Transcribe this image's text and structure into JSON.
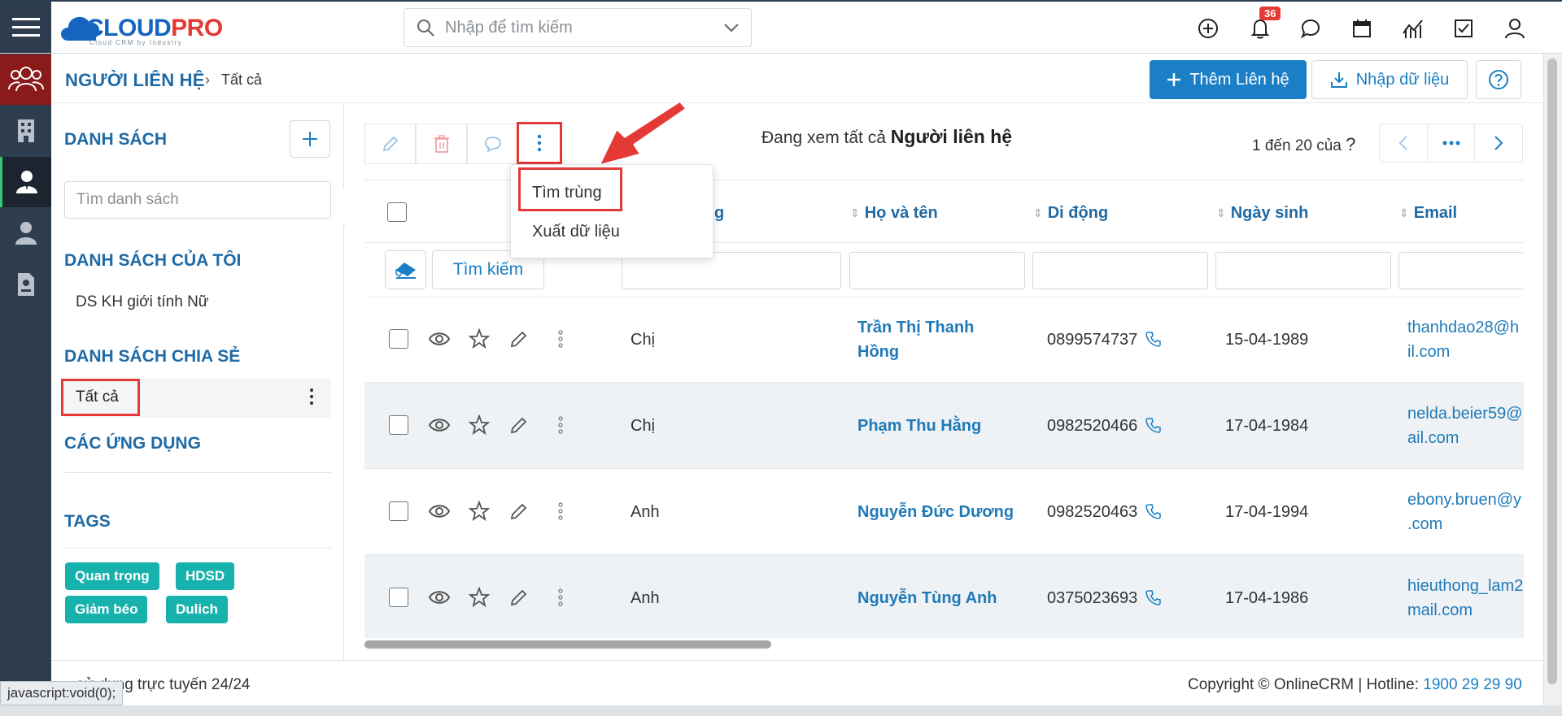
{
  "app": {
    "logo_main": "CLOUD",
    "logo_accent": "PRO",
    "logo_sub": "Cloud CRM by Industry"
  },
  "header": {
    "search_placeholder": "Nhập để tìm kiếm",
    "notification_count": "36"
  },
  "breadcrumb": {
    "module": "NGƯỜI LIÊN HỆ",
    "separator": "›",
    "current": "Tất cả"
  },
  "actions": {
    "add_contact": "Thêm Liên hệ",
    "import_data": "Nhập dữ liệu"
  },
  "sidebar": {
    "list_title": "DANH SÁCH",
    "list_search_placeholder": "Tìm danh sách",
    "my_lists_title": "DANH SÁCH CỦA TÔI",
    "my_lists": [
      "DS KH giới tính Nữ"
    ],
    "shared_title": "DANH SÁCH CHIA SẺ",
    "shared_lists": [
      "Tất cả"
    ],
    "apps_title": "CÁC ỨNG DỤNG",
    "tags_title": "TAGS",
    "tags": [
      "Quan trọng",
      "HDSD",
      "Giảm béo",
      "Dulich"
    ]
  },
  "toolbar": {
    "viewing_prefix": "Đang xem tất cả",
    "viewing_entity": "Người liên hệ",
    "pager_text": "1 đến 20 của",
    "pager_unknown": "?"
  },
  "dropdown": {
    "items": [
      "Tìm trùng",
      "Xuất dữ liệu"
    ]
  },
  "table": {
    "columns": [
      "g",
      "Họ và tên",
      "Di động",
      "Ngày sinh",
      "Email"
    ],
    "search_button": "Tìm kiếm",
    "rows": [
      {
        "salutation": "Chị",
        "name": "Trần Thị Thanh Hồng",
        "name_line1": "Trần Thị Thanh",
        "name_line2": "Hồng",
        "mobile": "0899574737",
        "birthday": "15-04-1989",
        "email_line1": "thanhdao28@h",
        "email_line2": "il.com"
      },
      {
        "salutation": "Chị",
        "name": "Phạm Thu Hằng",
        "mobile": "0982520466",
        "birthday": "17-04-1984",
        "email_line1": "nelda.beier59@",
        "email_line2": "ail.com"
      },
      {
        "salutation": "Anh",
        "name": "Nguyễn Đức Dương",
        "mobile": "0982520463",
        "birthday": "17-04-1994",
        "email_line1": "ebony.bruen@y",
        "email_line2": ".com"
      },
      {
        "salutation": "Anh",
        "name": "Nguyễn Tùng Anh",
        "mobile": "0375023693",
        "birthday": "17-04-1986",
        "email_line1": "hieuthong_lam2",
        "email_line2": "mail.com"
      }
    ]
  },
  "footer": {
    "left_text": "sử dụng trực tuyến 24/24",
    "copyright": "Copyright © OnlineCRM | Hotline: ",
    "hotline": "1900 29 29 90",
    "status_tip": "javascript:void(0);"
  },
  "colors": {
    "brand_blue": "#1a7fc4",
    "link_blue": "#1f6aa5",
    "tag_teal": "#17b2ad",
    "highlight_red": "#e53935",
    "rail_dark": "#2f3e4e"
  }
}
